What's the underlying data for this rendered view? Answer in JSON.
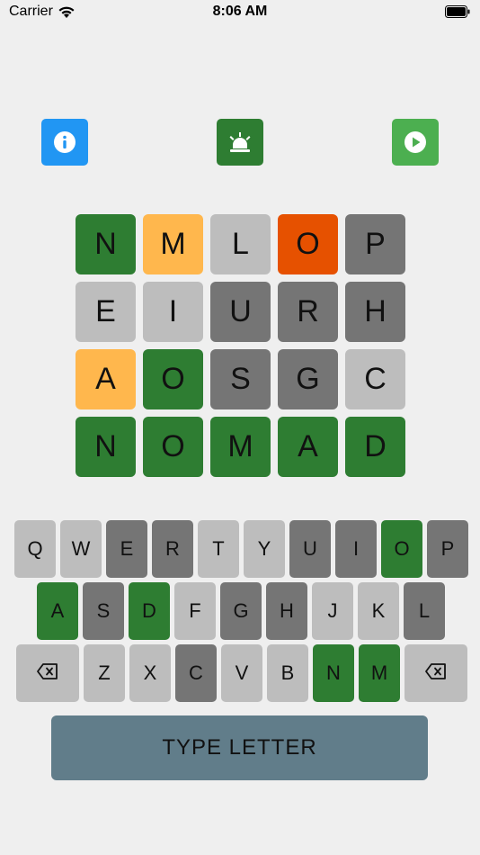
{
  "status_bar": {
    "carrier": "Carrier",
    "time": "8:06 AM"
  },
  "colors": {
    "green": "#2e7d32",
    "yellow": "#ffb74d",
    "orange": "#e65100",
    "light_gray": "#bdbdbd",
    "dark_gray": "#757575",
    "info_blue": "#2196f3",
    "alarm_green": "#2e7d32",
    "play_green": "#4caf50",
    "type_button": "#617d8a"
  },
  "toolbar": {
    "buttons": [
      {
        "name": "info-button",
        "icon": "info-icon"
      },
      {
        "name": "alarm-button",
        "icon": "alarm-icon"
      },
      {
        "name": "play-button",
        "icon": "play-icon"
      }
    ]
  },
  "board": {
    "rows": [
      [
        {
          "letter": "N",
          "state": "green"
        },
        {
          "letter": "M",
          "state": "yellow"
        },
        {
          "letter": "L",
          "state": "light"
        },
        {
          "letter": "O",
          "state": "orange"
        },
        {
          "letter": "P",
          "state": "dark"
        }
      ],
      [
        {
          "letter": "E",
          "state": "light"
        },
        {
          "letter": "I",
          "state": "light"
        },
        {
          "letter": "U",
          "state": "dark"
        },
        {
          "letter": "R",
          "state": "dark"
        },
        {
          "letter": "H",
          "state": "dark"
        }
      ],
      [
        {
          "letter": "A",
          "state": "yellow"
        },
        {
          "letter": "O",
          "state": "green"
        },
        {
          "letter": "S",
          "state": "dark"
        },
        {
          "letter": "G",
          "state": "dark"
        },
        {
          "letter": "C",
          "state": "light"
        }
      ],
      [
        {
          "letter": "N",
          "state": "green"
        },
        {
          "letter": "O",
          "state": "green"
        },
        {
          "letter": "M",
          "state": "green"
        },
        {
          "letter": "A",
          "state": "green"
        },
        {
          "letter": "D",
          "state": "green"
        }
      ]
    ]
  },
  "keyboard": {
    "rows": [
      [
        {
          "label": "Q",
          "state": "light"
        },
        {
          "label": "W",
          "state": "light"
        },
        {
          "label": "E",
          "state": "dark"
        },
        {
          "label": "R",
          "state": "dark"
        },
        {
          "label": "T",
          "state": "light"
        },
        {
          "label": "Y",
          "state": "light"
        },
        {
          "label": "U",
          "state": "dark"
        },
        {
          "label": "I",
          "state": "dark"
        },
        {
          "label": "O",
          "state": "green"
        },
        {
          "label": "P",
          "state": "dark"
        }
      ],
      [
        {
          "label": "A",
          "state": "green"
        },
        {
          "label": "S",
          "state": "dark"
        },
        {
          "label": "D",
          "state": "green"
        },
        {
          "label": "F",
          "state": "light"
        },
        {
          "label": "G",
          "state": "dark"
        },
        {
          "label": "H",
          "state": "dark"
        },
        {
          "label": "J",
          "state": "light"
        },
        {
          "label": "K",
          "state": "light"
        },
        {
          "label": "L",
          "state": "dark"
        }
      ],
      [
        {
          "label": "",
          "state": "light",
          "icon": "backspace-icon"
        },
        {
          "label": "Z",
          "state": "light"
        },
        {
          "label": "X",
          "state": "light"
        },
        {
          "label": "C",
          "state": "dark"
        },
        {
          "label": "V",
          "state": "light"
        },
        {
          "label": "B",
          "state": "light"
        },
        {
          "label": "N",
          "state": "green"
        },
        {
          "label": "M",
          "state": "green"
        },
        {
          "label": "",
          "state": "light",
          "icon": "backspace-icon"
        }
      ]
    ]
  },
  "action": {
    "label": "TYPE LETTER"
  }
}
